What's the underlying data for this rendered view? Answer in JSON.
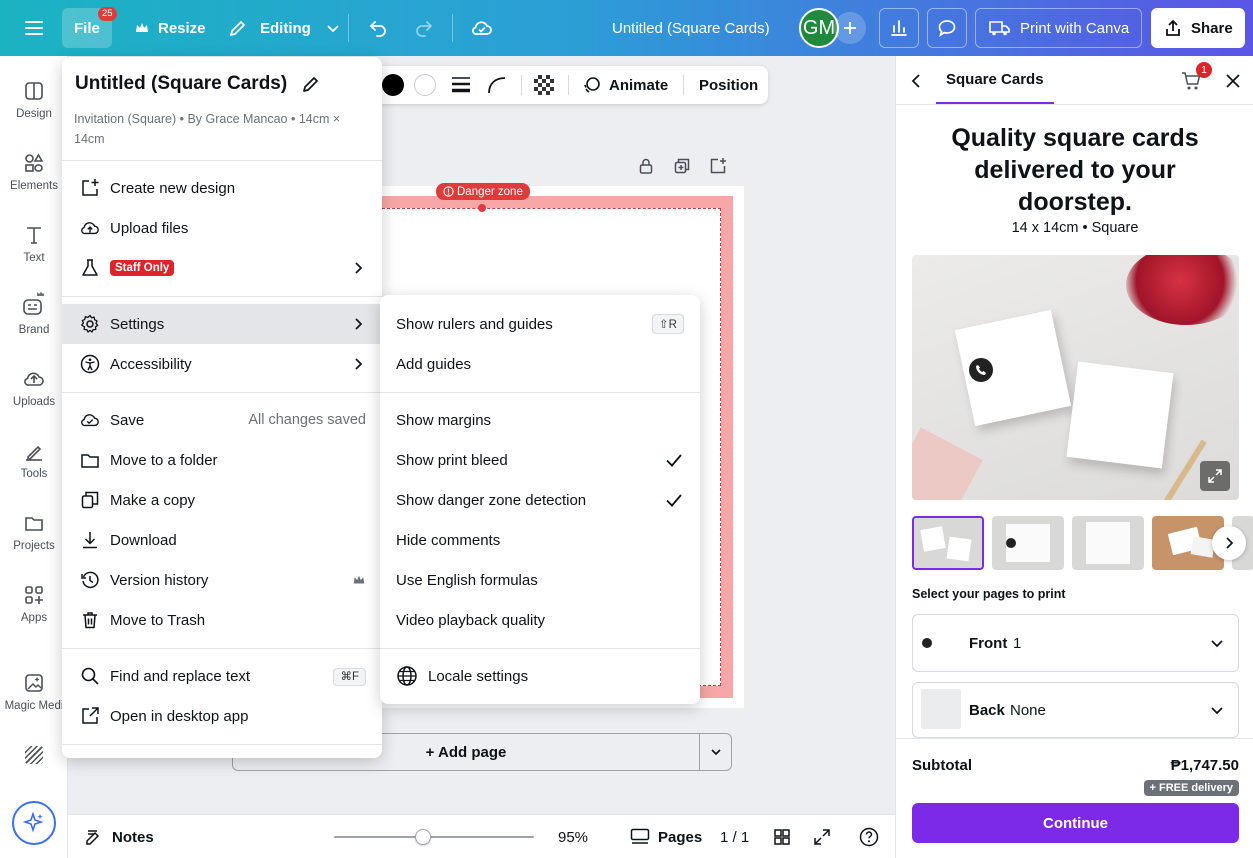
{
  "topbar": {
    "file_label": "File",
    "file_badge": "25",
    "resize_label": "Resize",
    "editing_label": "Editing",
    "doc_title": "Untitled (Square Cards)",
    "avatar_initials": "GM",
    "print_label": "Print with Canva",
    "share_label": "Share"
  },
  "leftrail": {
    "items": [
      {
        "label": "Design",
        "icon": "design-icon"
      },
      {
        "label": "Elements",
        "icon": "elements-icon"
      },
      {
        "label": "Text",
        "icon": "text-icon"
      },
      {
        "label": "Brand",
        "icon": "brand-icon"
      },
      {
        "label": "Uploads",
        "icon": "uploads-icon"
      },
      {
        "label": "Tools",
        "icon": "tools-icon"
      },
      {
        "label": "Projects",
        "icon": "projects-icon"
      },
      {
        "label": "Apps",
        "icon": "apps-icon"
      },
      {
        "label": "Magic Medi",
        "icon": "magic-media-icon"
      }
    ]
  },
  "context_toolbar": {
    "animate_label": "Animate",
    "position_label": "Position"
  },
  "canvas": {
    "danger_zone_label": "Danger zone",
    "add_page_label": "+ Add page"
  },
  "file_menu": {
    "title": "Untitled (Square Cards)",
    "subtitle": "Invitation (Square) • By Grace Mancao • 14cm × 14cm",
    "items": {
      "create_new_design": "Create new design",
      "upload_files": "Upload files",
      "staff_only": "Staff Only",
      "settings": "Settings",
      "accessibility": "Accessibility",
      "save": "Save",
      "save_status": "All changes saved",
      "move_to_folder": "Move to a folder",
      "make_copy": "Make a copy",
      "download": "Download",
      "version_history": "Version history",
      "move_to_trash": "Move to Trash",
      "find_replace": "Find and replace text",
      "find_replace_shortcut": "⌘F",
      "open_desktop": "Open in desktop app"
    }
  },
  "settings_submenu": {
    "show_rulers": "Show rulers and guides",
    "show_rulers_shortcut": "⇧R",
    "add_guides": "Add guides",
    "show_margins": "Show margins",
    "show_print_bleed": "Show print bleed",
    "show_print_bleed_checked": true,
    "show_danger_zone": "Show danger zone detection",
    "show_danger_zone_checked": true,
    "hide_comments": "Hide comments",
    "english_formulas": "Use English formulas",
    "video_quality": "Video playback quality",
    "locale_settings": "Locale settings"
  },
  "bottombar": {
    "notes_label": "Notes",
    "zoom_percent": 95,
    "zoom_label": "95%",
    "pages_label": "Pages",
    "page_count": "1 / 1"
  },
  "right_panel": {
    "tab_label": "Square Cards",
    "cart_badge": "1",
    "headline": "Quality square cards delivered to your doorstep.",
    "spec": "14 x 14cm • Square",
    "select_pages_label": "Select your pages to print",
    "front_label": "Front",
    "front_value": "1",
    "back_label": "Back",
    "back_value": "None",
    "subtotal_label": "Subtotal",
    "subtotal_value": "₱1,747.50",
    "free_delivery": "+ FREE delivery",
    "continue_label": "Continue"
  },
  "colors": {
    "accent_purple": "#7d2ae8",
    "danger_red": "#e03a3a",
    "bleed_pink": "#f7a7a7",
    "avatar_green": "#1f8a3c"
  }
}
